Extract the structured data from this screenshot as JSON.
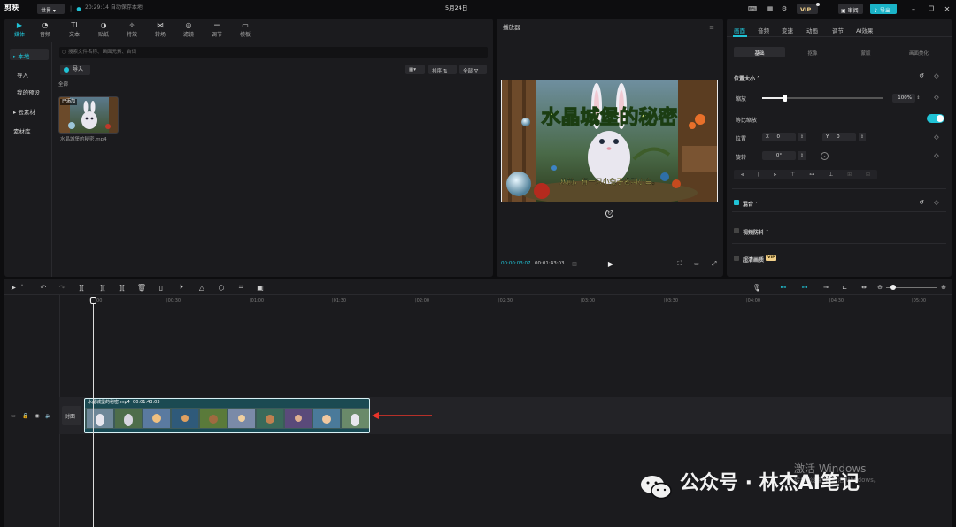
{
  "topbar": {
    "logo": "剪映",
    "profile": "世界",
    "autosave": "20:29:14 自动保存本地",
    "date": "5月24日",
    "vip": "VIP",
    "review": "审阅",
    "export": "导出"
  },
  "media": {
    "tabs": [
      {
        "label": "媒体",
        "icon": "media-icon"
      },
      {
        "label": "音频",
        "icon": "audio-icon"
      },
      {
        "label": "文本",
        "icon": "text-icon"
      },
      {
        "label": "贴纸",
        "icon": "sticker-icon"
      },
      {
        "label": "特效",
        "icon": "effects-icon"
      },
      {
        "label": "转场",
        "icon": "transition-icon"
      },
      {
        "label": "滤镜",
        "icon": "filter-icon"
      },
      {
        "label": "调节",
        "icon": "adjust-icon"
      },
      {
        "label": "模板",
        "icon": "template-icon"
      }
    ],
    "sidebar": [
      "本地",
      "导入",
      "我的预设",
      "云素材",
      "素材库"
    ],
    "search_placeholder": "搜索文件名称、画面元素、台词",
    "import": "导入",
    "sort": "排序",
    "all": "全部",
    "section": "全部",
    "file_name": "水晶城堡的秘密.mp4",
    "thumb_tag": "已添加"
  },
  "player": {
    "title": "播放器",
    "overlay_title": "水晶城堡的秘密",
    "overlay_sub": "从前，有一只小兔子名叫小白。",
    "time_current": "00:00:03:07",
    "time_total": "00:01:43:03"
  },
  "props": {
    "tabs": [
      "画面",
      "音频",
      "变速",
      "动画",
      "调节",
      "AI效果"
    ],
    "subtabs": [
      "基础",
      "抠像",
      "蒙版",
      "画面美化"
    ],
    "position_size": "位置大小",
    "scale": "缩放",
    "scale_value": "100%",
    "uniform_scale": "等比缩放",
    "position": "位置",
    "x_label": "X",
    "x_value": "0",
    "y_label": "Y",
    "y_value": "0",
    "rotation": "旋转",
    "rotation_value": "0°",
    "blend": "混合",
    "stabilize": "视频防抖",
    "super_res": "超清画质",
    "vip_badge": "VIP"
  },
  "timeline": {
    "ruler": [
      "00:00",
      "|00:30",
      "|01:00",
      "|01:30",
      "|02:00",
      "|02:30",
      "|03:00",
      "|03:30",
      "|04:00",
      "|04:30",
      "|05:00"
    ],
    "clip_name": "水晶城堡的秘密.mp4",
    "clip_duration": "00:01:43:03",
    "cover": "封面"
  },
  "watermark": {
    "activate": "激活 Windows",
    "activate_sub": "转到“设置”以激活 Windows。",
    "wechat": "公众号 · 林杰AI笔记"
  },
  "colors": {
    "accent": "#20c3d6",
    "panel": "#1b1b1e",
    "background": "#0d0d0f"
  }
}
